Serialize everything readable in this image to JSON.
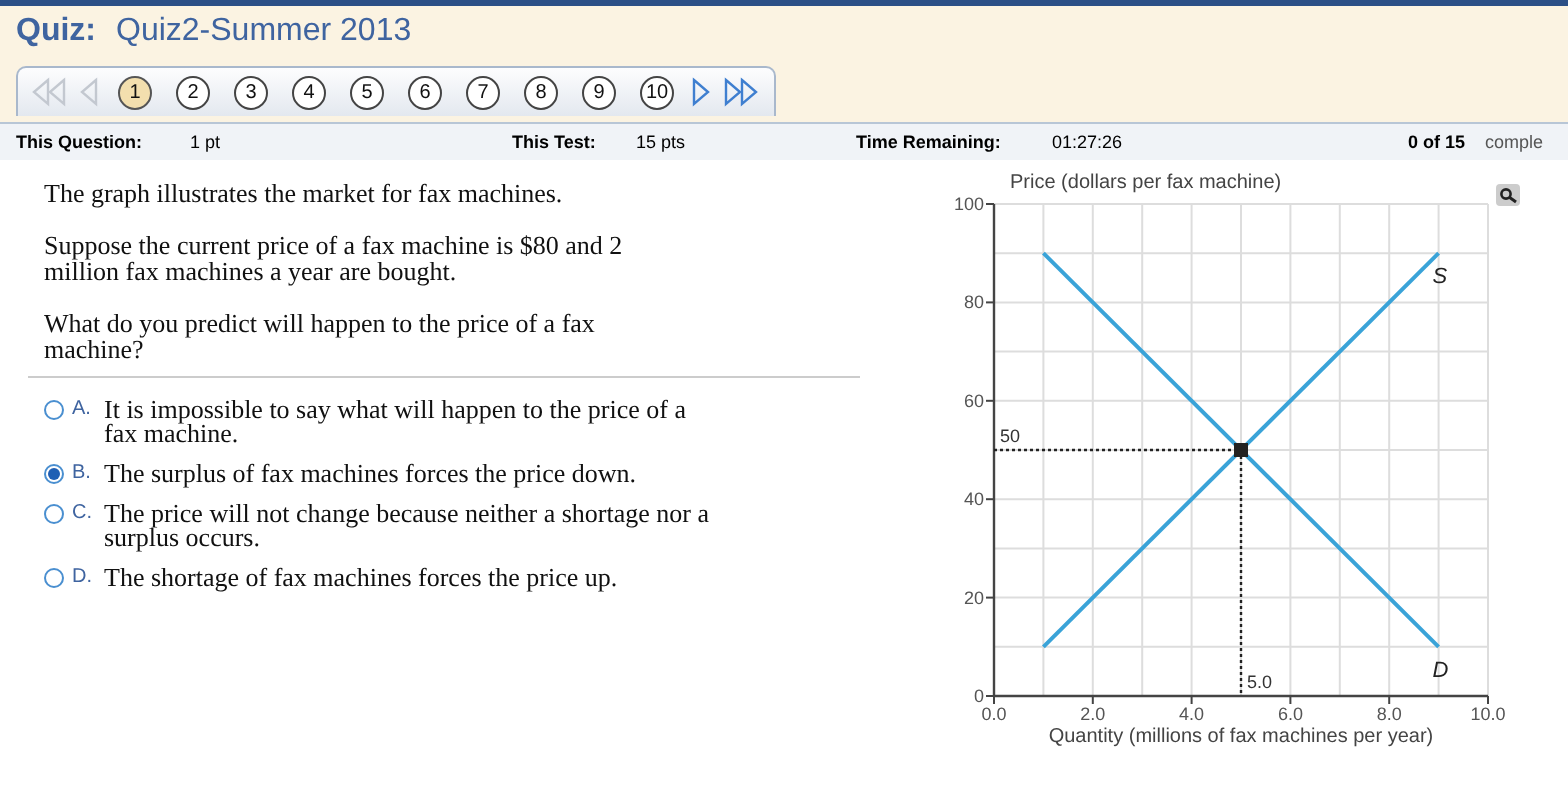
{
  "header": {
    "label": "Quiz:",
    "title": "Quiz2-Summer 2013"
  },
  "nav": {
    "first": {
      "disabled": true
    },
    "prev": {
      "disabled": true
    },
    "next": {
      "disabled": false
    },
    "last": {
      "disabled": false
    },
    "questions": [
      {
        "label": "1",
        "selected": true
      },
      {
        "label": "2",
        "selected": false
      },
      {
        "label": "3",
        "selected": false
      },
      {
        "label": "4",
        "selected": false
      },
      {
        "label": "5",
        "selected": false
      },
      {
        "label": "6",
        "selected": false
      },
      {
        "label": "7",
        "selected": false
      },
      {
        "label": "8",
        "selected": false
      },
      {
        "label": "9",
        "selected": false
      },
      {
        "label": "10",
        "selected": false
      }
    ]
  },
  "info_bar": {
    "question_label": "This Question:",
    "question_value": "1 pt",
    "test_label": "This Test:",
    "test_value": "15 pts",
    "time_label": "Time Remaining:",
    "time_value": "01:27:26",
    "progress": "0 of 15",
    "progress_label": "comple"
  },
  "question": {
    "paragraphs": [
      "The graph illustrates the market for fax machines.",
      "Suppose the current price of a fax machine is $80 and 2 million fax machines a year are bought.",
      "What do you predict will happen to the price of a fax machine?"
    ],
    "choices": [
      {
        "letter": "A.",
        "text": "It is impossible to say what will happen to the price of a fax machine.",
        "selected": false
      },
      {
        "letter": "B.",
        "text": "The surplus of fax machines forces the price down.",
        "selected": true
      },
      {
        "letter": "C.",
        "text": "The price will not change because neither a shortage nor a surplus occurs.",
        "selected": false
      },
      {
        "letter": "D.",
        "text": "The shortage of fax machines forces the price up.",
        "selected": false
      }
    ]
  },
  "chart_data": {
    "type": "line",
    "grid": true,
    "x": [
      1,
      9
    ],
    "xlabel": "Quantity (millions of fax machines per year)",
    "ylabel": "Price (dollars per fax machine)",
    "xlim": [
      0,
      10
    ],
    "ylim": [
      0,
      100
    ],
    "xticks": [
      {
        "value": 0,
        "label": "0.0"
      },
      {
        "value": 2,
        "label": "2.0"
      },
      {
        "value": 4,
        "label": "4.0"
      },
      {
        "value": 6,
        "label": "6.0"
      },
      {
        "value": 8,
        "label": "8.0"
      },
      {
        "value": 10,
        "label": "10.0"
      }
    ],
    "yticks": [
      0,
      20,
      40,
      60,
      80,
      100
    ],
    "series": [
      {
        "name": "S",
        "color": "#3aa3d8",
        "values": [
          10,
          90
        ]
      },
      {
        "name": "D",
        "color": "#3aa3d8",
        "values": [
          90,
          10
        ]
      }
    ],
    "annotations": [
      {
        "text": "50",
        "x": 5,
        "y": 50
      },
      {
        "text": "5.0",
        "x": 5,
        "y": 50
      }
    ]
  }
}
